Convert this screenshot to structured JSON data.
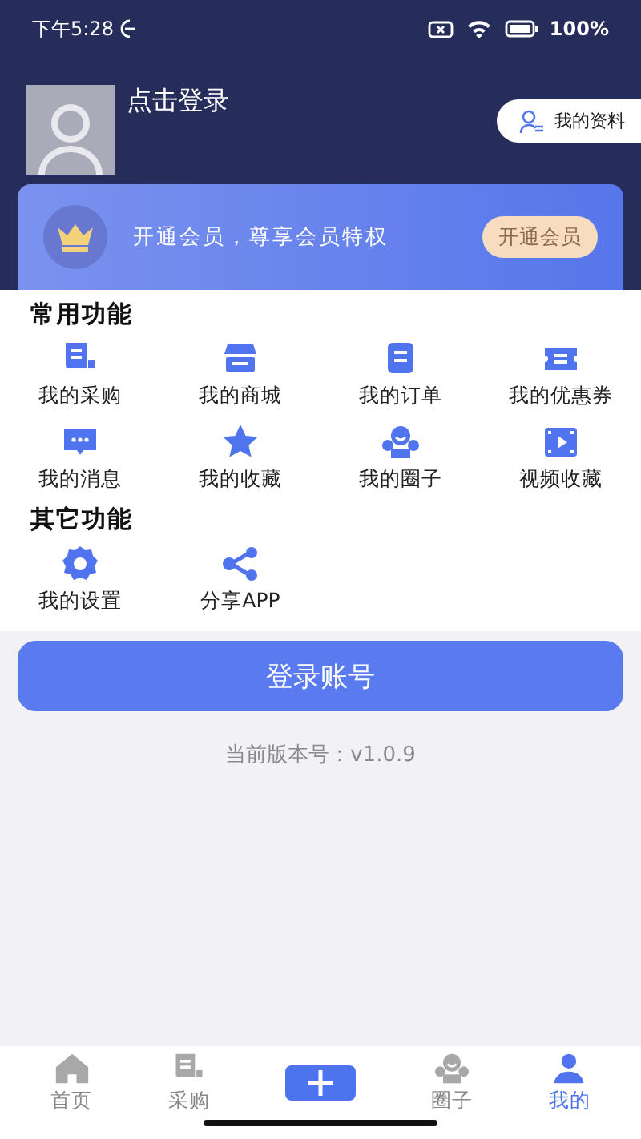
{
  "status_bar": {
    "time": "下午5:28",
    "battery": "100%"
  },
  "profile": {
    "login_text": "点击登录",
    "profile_button": "我的资料"
  },
  "member_banner": {
    "text": "开通会员，尊享会员特权",
    "button": "开通会员"
  },
  "sections": [
    {
      "title": "常用功能",
      "items": [
        {
          "label": "我的采购",
          "kind": "purchase"
        },
        {
          "label": "我的商城",
          "kind": "shop"
        },
        {
          "label": "我的订单",
          "kind": "order"
        },
        {
          "label": "我的优惠券",
          "kind": "coupon"
        },
        {
          "label": "我的消息",
          "kind": "message"
        },
        {
          "label": "我的收藏",
          "kind": "star"
        },
        {
          "label": "我的圈子",
          "kind": "group"
        },
        {
          "label": "视频收藏",
          "kind": "video"
        }
      ]
    },
    {
      "title": "其它功能",
      "items": [
        {
          "label": "我的设置",
          "kind": "settings"
        },
        {
          "label": "分享APP",
          "kind": "share"
        }
      ]
    }
  ],
  "login_button": "登录账号",
  "version_text": "当前版本号：v1.0.9",
  "tab_bar": [
    {
      "label": "首页",
      "kind": "home",
      "selected": false
    },
    {
      "label": "采购",
      "kind": "purchase",
      "selected": false
    },
    {
      "kind": "add"
    },
    {
      "label": "圈子",
      "kind": "group",
      "selected": false
    },
    {
      "label": "我的",
      "kind": "user",
      "selected": true
    }
  ]
}
